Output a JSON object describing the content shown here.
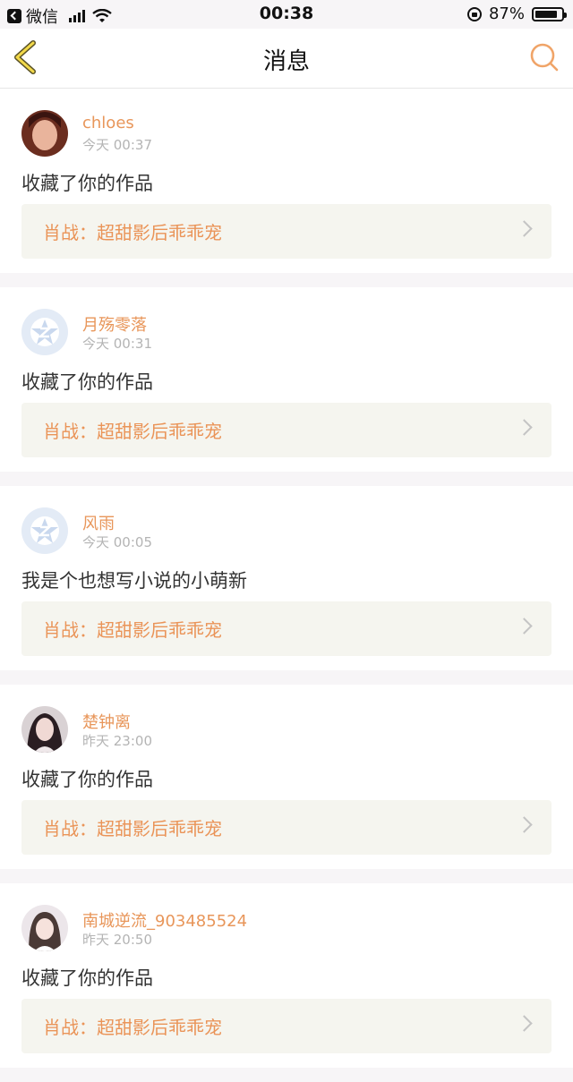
{
  "status_bar": {
    "carrier": "微信",
    "time": "00:38",
    "battery": "87%"
  },
  "navbar": {
    "title": "消息"
  },
  "messages": [
    {
      "user": "chloes",
      "time": "今天 00:37",
      "content": "收藏了你的作品",
      "work": "肖战：超甜影后乖乖宠"
    },
    {
      "user": "月殇零落",
      "time": "今天 00:31",
      "content": "收藏了你的作品",
      "work": "肖战：超甜影后乖乖宠"
    },
    {
      "user": "风雨",
      "time": "今天 00:05",
      "content": "我是个也想写小说的小萌新",
      "work": "肖战：超甜影后乖乖宠"
    },
    {
      "user": "楚钟离",
      "time": "昨天 23:00",
      "content": "收藏了你的作品",
      "work": "肖战：超甜影后乖乖宠"
    },
    {
      "user": "南城逆流_903485524",
      "time": "昨天 20:50",
      "content": "收藏了你的作品",
      "work": "肖战：超甜影后乖乖宠"
    }
  ]
}
